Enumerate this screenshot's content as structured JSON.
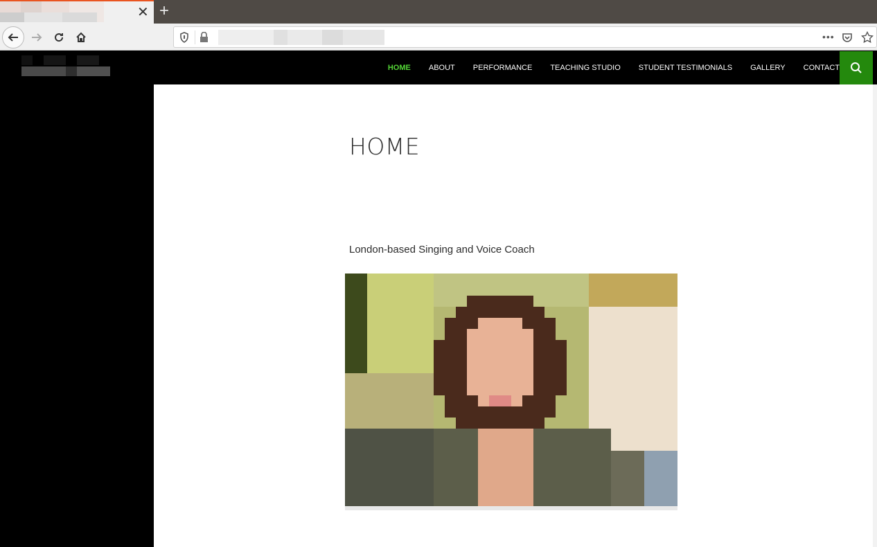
{
  "browser": {
    "tab": {
      "title": "",
      "close_icon": "close-icon"
    },
    "new_tab_icon": "plus-icon",
    "nav": {
      "back": "back-arrow-icon",
      "forward": "forward-arrow-icon",
      "reload": "reload-icon",
      "home": "home-icon"
    },
    "url": {
      "value": "",
      "shield_icon": "shield-icon",
      "lock_icon": "lock-icon"
    },
    "toolbar_right": {
      "more": "•••",
      "pocket": "pocket-icon",
      "bookmark": "star-icon"
    }
  },
  "site": {
    "menu": [
      {
        "label": "HOME",
        "active": true
      },
      {
        "label": "ABOUT"
      },
      {
        "label": "PERFORMANCE"
      },
      {
        "label": "TEACHING STUDIO"
      },
      {
        "label": "STUDENT TESTIMONIALS"
      },
      {
        "label": "GALLERY"
      },
      {
        "label": "CONTACT"
      }
    ],
    "search_icon": "search-icon",
    "accent_color": "#24890d",
    "active_menu_color": "#55d737"
  },
  "page": {
    "title": "HOME",
    "tagline": "London-based Singing and Voice Coach",
    "photo_alt": "Portrait photo (pixelated)"
  }
}
